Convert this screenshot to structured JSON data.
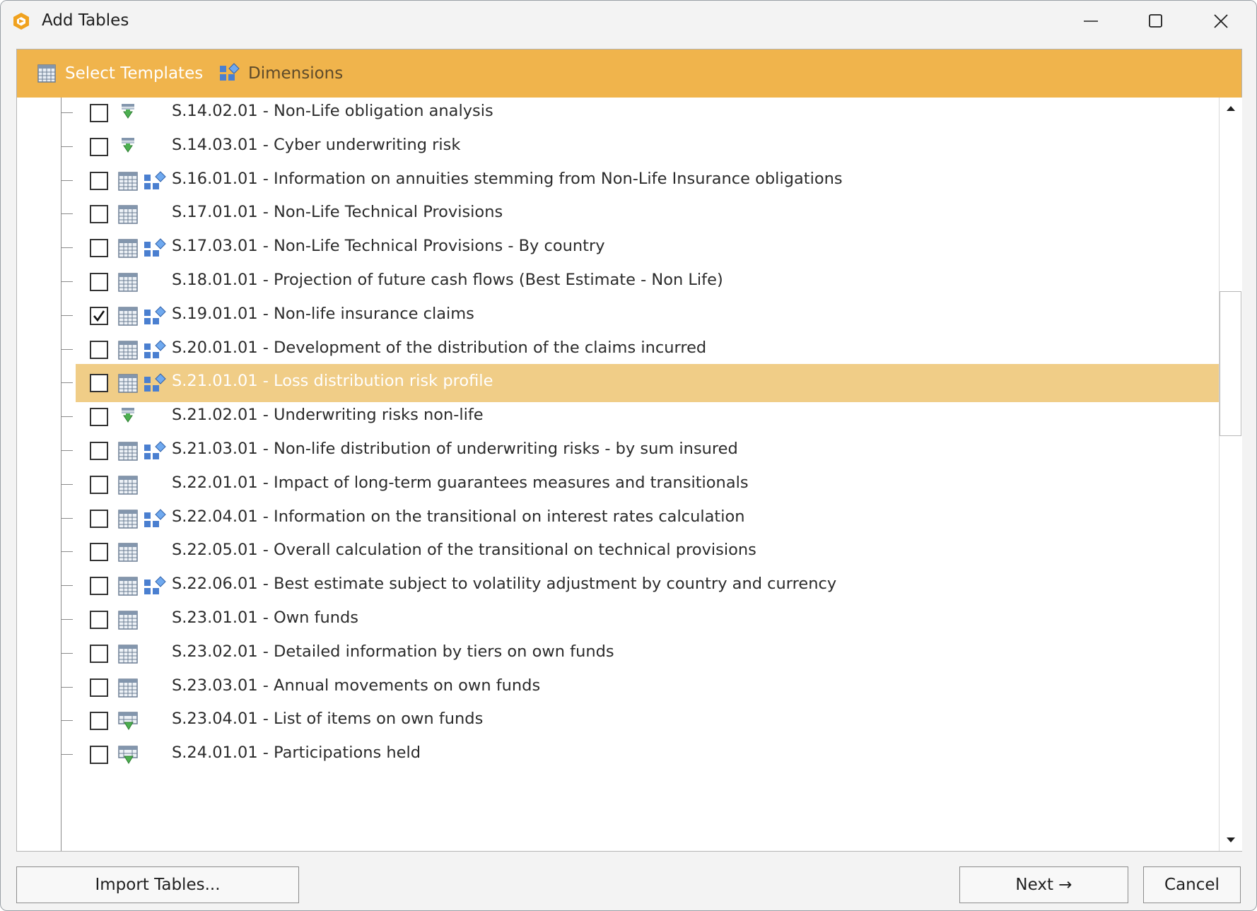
{
  "window": {
    "title": "Add Tables"
  },
  "tabs": {
    "templates": "Select Templates",
    "dimensions": "Dimensions"
  },
  "colors": {
    "header": "#f0b44c",
    "selected_row": "#f0cd87"
  },
  "rows": [
    {
      "label": "S.14.02.01 - Non-Life obligation analysis",
      "checked": false,
      "icon": "download-arrow-icon",
      "dim": false
    },
    {
      "label": "S.14.03.01 - Cyber underwriting risk",
      "checked": false,
      "icon": "download-arrow-icon",
      "dim": false
    },
    {
      "label": "S.16.01.01 - Information on annuities stemming from Non-Life Insurance obligations",
      "checked": false,
      "icon": "table-grid-icon",
      "dim": true
    },
    {
      "label": "S.17.01.01 - Non-Life Technical Provisions",
      "checked": false,
      "icon": "table-grid-icon",
      "dim": false
    },
    {
      "label": "S.17.03.01 - Non-Life Technical Provisions - By country",
      "checked": false,
      "icon": "table-grid-icon",
      "dim": true
    },
    {
      "label": "S.18.01.01 - Projection of future cash flows (Best Estimate - Non Life)",
      "checked": false,
      "icon": "table-grid-icon",
      "dim": false
    },
    {
      "label": "S.19.01.01 - Non-life insurance claims",
      "checked": true,
      "icon": "table-grid-icon",
      "dim": true
    },
    {
      "label": "S.20.01.01 - Development of the distribution of the claims incurred",
      "checked": false,
      "icon": "table-grid-icon",
      "dim": true
    },
    {
      "label": "S.21.01.01 - Loss distribution risk profile",
      "checked": false,
      "icon": "table-grid-icon",
      "dim": true,
      "selected": true
    },
    {
      "label": "S.21.02.01 - Underwriting risks non-life",
      "checked": false,
      "icon": "download-arrow-icon",
      "dim": false
    },
    {
      "label": "S.21.03.01 - Non-life distribution of underwriting risks - by sum insured",
      "checked": false,
      "icon": "table-grid-icon",
      "dim": true
    },
    {
      "label": "S.22.01.01 - Impact of long-term guarantees measures and transitionals",
      "checked": false,
      "icon": "table-grid-icon",
      "dim": false
    },
    {
      "label": "S.22.04.01 - Information on the transitional on interest rates calculation",
      "checked": false,
      "icon": "table-grid-icon",
      "dim": true
    },
    {
      "label": "S.22.05.01 - Overall calculation of the transitional on technical provisions",
      "checked": false,
      "icon": "table-grid-icon",
      "dim": false
    },
    {
      "label": "S.22.06.01 - Best estimate subject to volatility adjustment by country and currency",
      "checked": false,
      "icon": "table-grid-icon",
      "dim": true
    },
    {
      "label": "S.23.01.01 - Own funds",
      "checked": false,
      "icon": "table-grid-icon",
      "dim": false
    },
    {
      "label": "S.23.02.01 - Detailed information by tiers on own funds",
      "checked": false,
      "icon": "table-grid-icon",
      "dim": false
    },
    {
      "label": "S.23.03.01 - Annual movements on own funds",
      "checked": false,
      "icon": "table-grid-icon",
      "dim": false
    },
    {
      "label": "S.23.04.01 - List of items on own funds",
      "checked": false,
      "icon": "table-download-icon",
      "dim": false
    },
    {
      "label": "S.24.01.01 - Participations held",
      "checked": false,
      "icon": "table-download-icon",
      "dim": false
    }
  ],
  "buttons": {
    "import": "Import Tables...",
    "next": "Next →",
    "cancel": "Cancel"
  }
}
